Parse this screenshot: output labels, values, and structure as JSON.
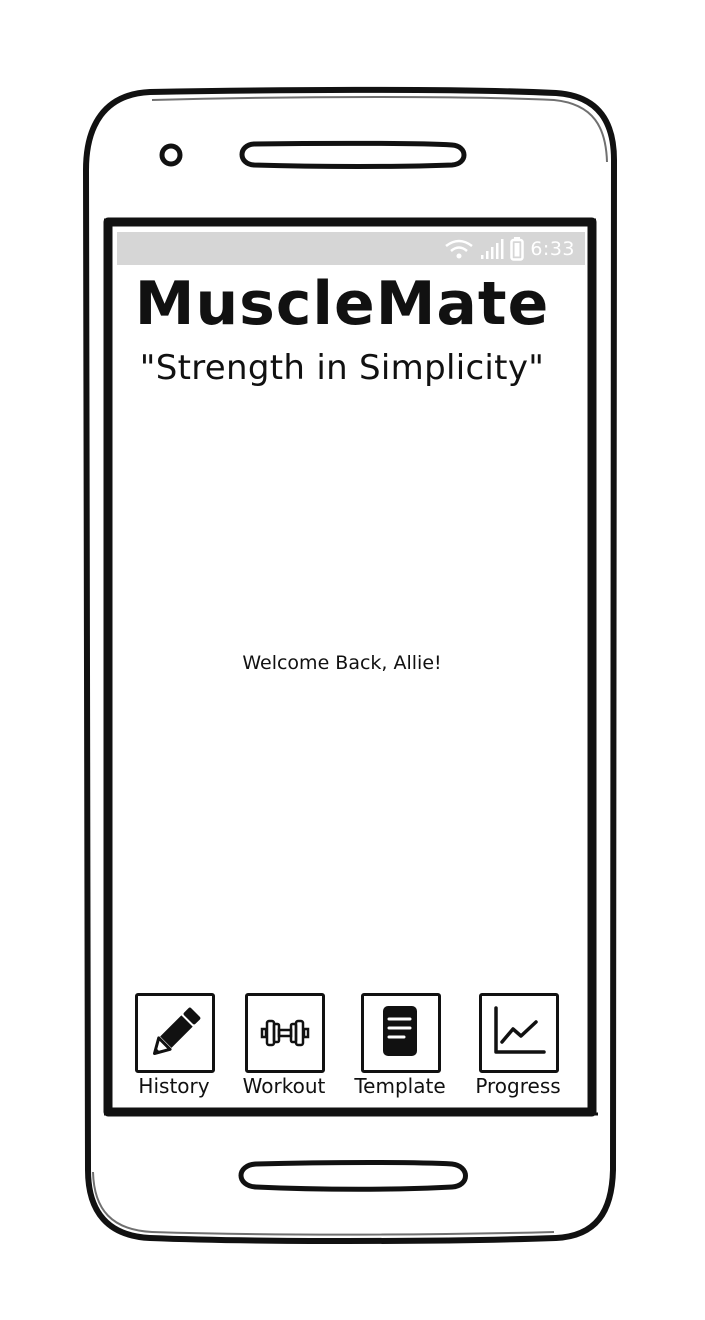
{
  "status_bar": {
    "time": "6:33",
    "icons": [
      "wifi-icon",
      "signal-icon",
      "battery-icon"
    ],
    "background_color": "#d6d6d6"
  },
  "app": {
    "title": "MuscleMate",
    "tagline": "\"Strength in Simplicity\"",
    "welcome_message": "Welcome Back, Allie!"
  },
  "bottom_nav": {
    "items": [
      {
        "label": "History",
        "icon": "pencil-icon"
      },
      {
        "label": "Workout",
        "icon": "dumbbell-icon"
      },
      {
        "label": "Template",
        "icon": "document-icon"
      },
      {
        "label": "Progress",
        "icon": "line-chart-icon"
      }
    ]
  }
}
